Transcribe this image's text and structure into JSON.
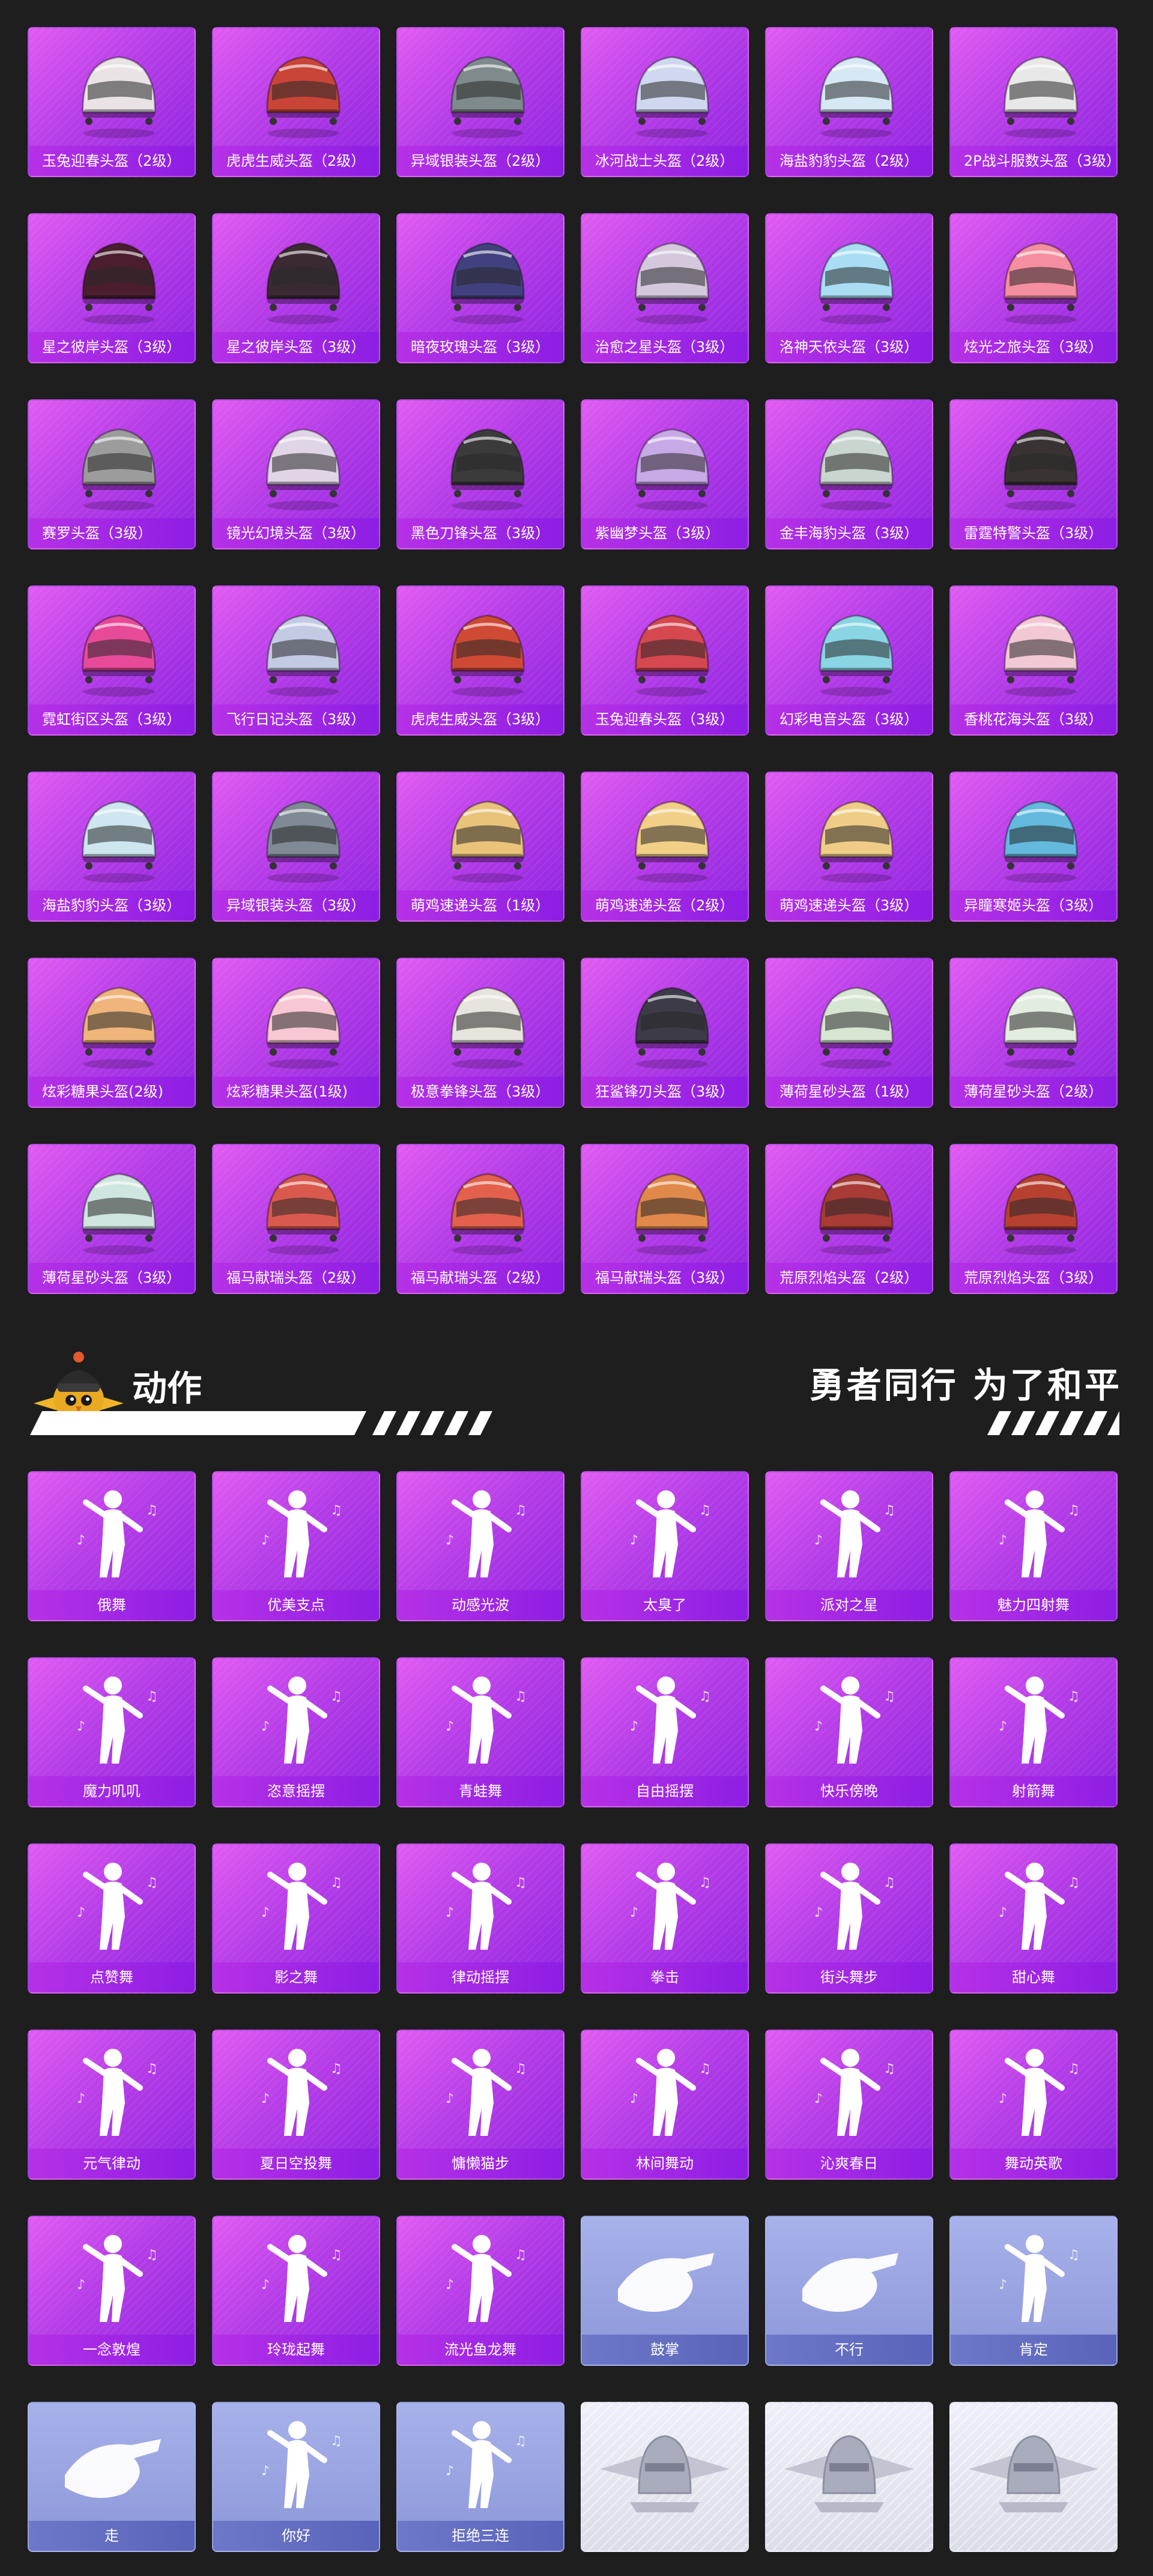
{
  "colors": {
    "background": "#1e1e1e",
    "card_purple": "#b63de8",
    "card_blue": "#8c97d9",
    "card_silver": "#e4e5f0",
    "label_text": "#ffffff"
  },
  "helmet_rows": [
    [
      "玉兔迎春头盔（2级）",
      "虎虎生威头盔（2级）",
      "异域银装头盔（2级）",
      "冰河战士头盔（2级）",
      "海盐豹豹头盔（2级）",
      "2P战斗服数头盔（3级）"
    ],
    [
      "星之彼岸头盔（3级）",
      "星之彼岸头盔（3级）",
      "暗夜玫瑰头盔（3级）",
      "治愈之星头盔（3级）",
      "洛神天依头盔（3级）",
      "炫光之旅头盔（3级）"
    ],
    [
      "赛罗头盔（3级）",
      "镜光幻境头盔（3级）",
      "黑色刀锋头盔（3级）",
      "紫幽梦头盔（3级）",
      "金丰海豹头盔（3级）",
      "雷霆特警头盔（3级）"
    ],
    [
      "霓虹街区头盔（3级）",
      "飞行日记头盔（3级）",
      "虎虎生威头盔（3级）",
      "玉兔迎春头盔（3级）",
      "幻彩电音头盔（3级）",
      "香桃花海头盔（3级）"
    ],
    [
      "海盐豹豹头盔（3级）",
      "异域银装头盔（3级）",
      "萌鸡速递头盔（1级）",
      "萌鸡速递头盔（2级）",
      "萌鸡速递头盔（3级）",
      "异瞳寒姬头盔（3级）"
    ],
    [
      "炫彩糖果头盔(2级)",
      "炫彩糖果头盔(1级)",
      "极意拳锋头盔（3级）",
      "狂鲨锋刃头盔（3级）",
      "薄荷星砂头盔（1级）",
      "薄荷星砂头盔（2级）"
    ],
    [
      "薄荷星砂头盔（3级）",
      "福马献瑞头盔（2级）",
      "福马献瑞头盔（2级）",
      "福马献瑞头盔（3级）",
      "荒原烈焰头盔（2级）",
      "荒原烈焰头盔（3级）"
    ]
  ],
  "helmet_icons": [
    [
      "rabbit-helmet-icon",
      "tiger-helmet-icon",
      "silver-helmet-icon",
      "glacier-helmet-icon",
      "seal-helmet-icon",
      "combat-helmet-icon"
    ],
    [
      "star-helmet-icon",
      "star-helmet-icon",
      "rose-helmet-icon",
      "heal-star-helmet-icon",
      "tianyi-helmet-icon",
      "glow-helmet-icon"
    ],
    [
      "zero-helmet-icon",
      "mirror-helmet-icon",
      "blade-helmet-icon",
      "purple-dream-helmet-icon",
      "gold-seal-helmet-icon",
      "swat-helmet-icon"
    ],
    [
      "neon-helmet-icon",
      "flight-helmet-icon",
      "tiger-helmet-icon",
      "rabbit-helmet-icon",
      "electro-helmet-icon",
      "peach-helmet-icon"
    ],
    [
      "seal-helmet-icon",
      "silver-helmet-icon",
      "chick-helmet-icon",
      "chick-helmet-icon",
      "chick-helmet-icon",
      "ice-eye-helmet-icon"
    ],
    [
      "candy-helmet-icon",
      "candy-helmet-icon",
      "fist-helmet-icon",
      "shark-helmet-icon",
      "mint-helmet-icon",
      "mint-helmet-icon"
    ],
    [
      "mint-helmet-icon",
      "horse-helmet-icon",
      "horse-helmet-icon",
      "horse-helmet-icon",
      "flame-helmet-icon",
      "flame-helmet-icon"
    ]
  ],
  "helmet_colors": [
    [
      "#e9e3e6",
      "#c84538",
      "#7f8a8d",
      "#cfd8ee",
      "#d6e8f3",
      "#e8e8e8"
    ],
    [
      "#4a1e2e",
      "#3b2a33",
      "#41417f",
      "#d3c8dc",
      "#a8ddf4",
      "#f58ea0"
    ],
    [
      "#9c9c9c",
      "#e0d5e6",
      "#3b3b3b",
      "#c7a9e6",
      "#c9d5cf",
      "#3a3334"
    ],
    [
      "#e74a98",
      "#c3cbe4",
      "#cf4a35",
      "#d54850",
      "#8ad5e4",
      "#f2c8d4"
    ],
    [
      "#cde6ef",
      "#7f8a96",
      "#e9c37a",
      "#f1cf87",
      "#f0cd86",
      "#63b9de"
    ],
    [
      "#f0b57b",
      "#f7c8d3",
      "#e6e4dc",
      "#3d3b47",
      "#d6e6d2",
      "#e3ece0"
    ],
    [
      "#cfe6e0",
      "#d9594e",
      "#e3604d",
      "#e0894b",
      "#a83b35",
      "#b74131"
    ]
  ],
  "section": {
    "title": "动作",
    "slogan": "勇者同行 为了和平",
    "mascot_icon": "chick-mascot-icon"
  },
  "emote_rows": [
    [
      {
        "label": "俄舞",
        "style": "purple"
      },
      {
        "label": "优美支点",
        "style": "purple"
      },
      {
        "label": "动感光波",
        "style": "purple"
      },
      {
        "label": "太臭了",
        "style": "purple"
      },
      {
        "label": "派对之星",
        "style": "purple"
      },
      {
        "label": "魅力四射舞",
        "style": "purple"
      }
    ],
    [
      {
        "label": "魔力叽叽",
        "style": "purple"
      },
      {
        "label": "恣意摇摆",
        "style": "purple"
      },
      {
        "label": "青蛙舞",
        "style": "purple"
      },
      {
        "label": "自由摇摆",
        "style": "purple"
      },
      {
        "label": "快乐傍晚",
        "style": "purple"
      },
      {
        "label": "射箭舞",
        "style": "purple"
      }
    ],
    [
      {
        "label": "点赞舞",
        "style": "purple"
      },
      {
        "label": "影之舞",
        "style": "purple"
      },
      {
        "label": "律动摇摆",
        "style": "purple"
      },
      {
        "label": "拳击",
        "style": "purple"
      },
      {
        "label": "街头舞步",
        "style": "purple"
      },
      {
        "label": "甜心舞",
        "style": "purple"
      }
    ],
    [
      {
        "label": "元气律动",
        "style": "purple"
      },
      {
        "label": "夏日空投舞",
        "style": "purple"
      },
      {
        "label": "慵懒猫步",
        "style": "purple"
      },
      {
        "label": "林间舞动",
        "style": "purple"
      },
      {
        "label": "沁爽春日",
        "style": "purple"
      },
      {
        "label": "舞动英歌",
        "style": "purple"
      }
    ],
    [
      {
        "label": "一念敦煌",
        "style": "purple"
      },
      {
        "label": "玲珑起舞",
        "style": "purple"
      },
      {
        "label": "流光鱼龙舞",
        "style": "purple"
      },
      {
        "label": "鼓掌",
        "style": "blue"
      },
      {
        "label": "不行",
        "style": "blue"
      },
      {
        "label": "肯定",
        "style": "blue"
      }
    ],
    [
      {
        "label": "走",
        "style": "blue"
      },
      {
        "label": "你好",
        "style": "blue"
      },
      {
        "label": "拒绝三连",
        "style": "blue"
      },
      {
        "label": "",
        "style": "silver"
      },
      {
        "label": "",
        "style": "silver"
      },
      {
        "label": "",
        "style": "silver"
      }
    ]
  ],
  "emote_icons": [
    [
      "dancer-icon",
      "dancer-icon",
      "dancer-icon",
      "dancer-icon",
      "dancer-icon",
      "dancer-icon"
    ],
    [
      "dancer-icon",
      "dancer-icon",
      "dancer-icon",
      "dancer-icon",
      "dancer-icon",
      "dancer-icon"
    ],
    [
      "dancer-icon",
      "dancer-icon",
      "dancer-icon",
      "boxer-icon",
      "dancer-icon",
      "dancer-icon"
    ],
    [
      "dancer-icon",
      "dancer-icon",
      "dancer-icon",
      "dancer-icon",
      "dancer-icon",
      "bubble-dancer-icon"
    ],
    [
      "dancer-icon",
      "dancer-icon",
      "dancer-icon",
      "clap-hands-icon",
      "refuse-hand-icon",
      "nod-head-icon"
    ],
    [
      "pointing-hand-icon",
      "wave-hello-icon",
      "cross-arms-icon",
      "winged-helmet-emblem-icon",
      "winged-helmet-emblem-icon",
      "winged-helmet-emblem-icon"
    ]
  ]
}
